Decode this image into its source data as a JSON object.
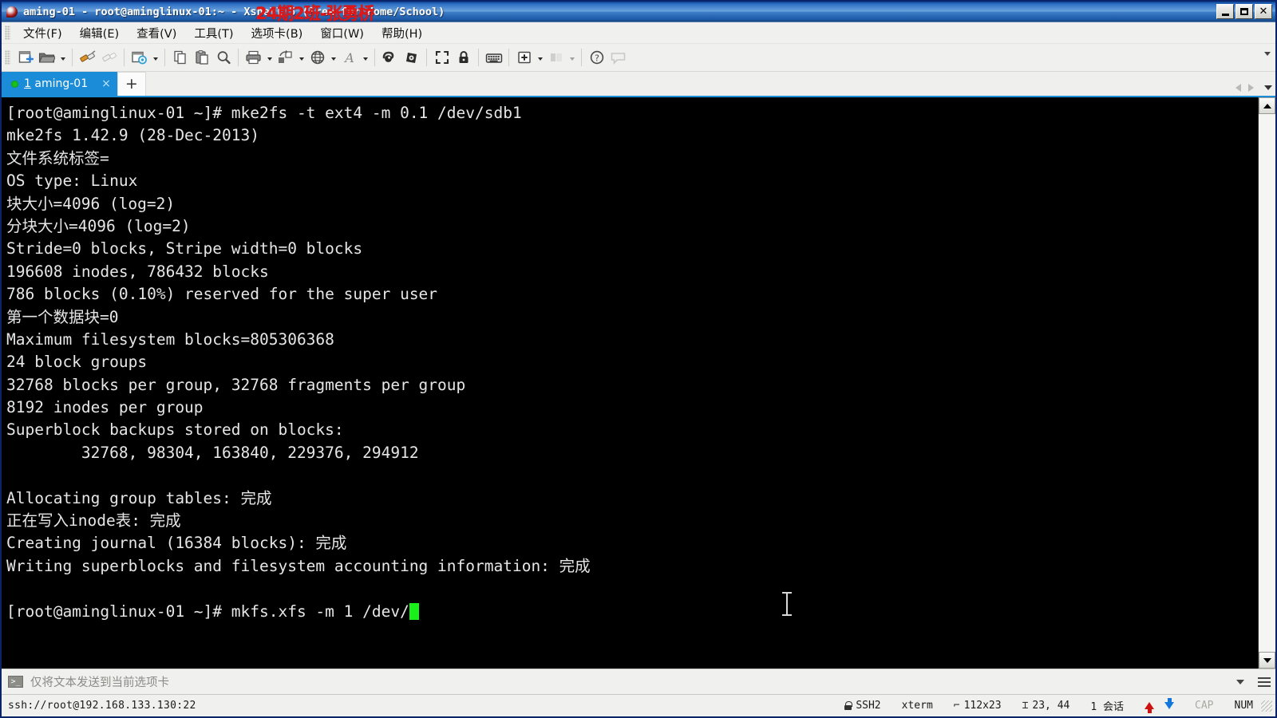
{
  "window": {
    "app_icon": "xshell-icon",
    "title": "aming-01 - root@aminglinux-01:~ - Xshell 5 (Free for Home/School)",
    "watermark": "24期2班-张勇桥",
    "minimize_label": "最小化",
    "maximize_label": "最大化",
    "close_label": "关闭"
  },
  "menubar": {
    "items": [
      {
        "label": "文件(F)",
        "name": "menu-file"
      },
      {
        "label": "编辑(E)",
        "name": "menu-edit"
      },
      {
        "label": "查看(V)",
        "name": "menu-view"
      },
      {
        "label": "工具(T)",
        "name": "menu-tools"
      },
      {
        "label": "选项卡(B)",
        "name": "menu-tabs"
      },
      {
        "label": "窗口(W)",
        "name": "menu-window"
      },
      {
        "label": "帮助(H)",
        "name": "menu-help"
      }
    ]
  },
  "toolbar": {
    "icons": [
      "new-session-icon",
      "open-folder-icon",
      "connect-plug-icon",
      "disconnect-plug-icon",
      "session-properties-icon",
      "copy-icon",
      "paste-icon",
      "find-icon",
      "print-icon",
      "file-transfer-icon",
      "web-browser-icon",
      "font-size-icon",
      "script-record-icon",
      "script-run-icon",
      "fullscreen-icon",
      "lock-session-icon",
      "keyboard-icon",
      "add-tab-icon",
      "arrange-layout-icon",
      "help-icon",
      "chat-icon"
    ]
  },
  "tabs": {
    "active": {
      "index": "1",
      "label": " aming-01",
      "status_dot_color": "#19c219",
      "close_label": "×"
    },
    "new_tab_label": "+",
    "nav_left": "prev-tab-arrow",
    "nav_right": "next-tab-arrow",
    "nav_menu": "tab-list-chevron"
  },
  "terminal": {
    "font_color": "#e6e6e6",
    "background": "#000000",
    "cursor_color": "#19f019",
    "lines": [
      "[root@aminglinux-01 ~]# mke2fs -t ext4 -m 0.1 /dev/sdb1",
      "mke2fs 1.42.9 (28-Dec-2013)",
      "文件系统标签=",
      "OS type: Linux",
      "块大小=4096 (log=2)",
      "分块大小=4096 (log=2)",
      "Stride=0 blocks, Stripe width=0 blocks",
      "196608 inodes, 786432 blocks",
      "786 blocks (0.10%) reserved for the super user",
      "第一个数据块=0",
      "Maximum filesystem blocks=805306368",
      "24 block groups",
      "32768 blocks per group, 32768 fragments per group",
      "8192 inodes per group",
      "Superblock backups stored on blocks:",
      "        32768, 98304, 163840, 229376, 294912",
      "",
      "Allocating group tables: 完成",
      "正在写入inode表: 完成",
      "Creating journal (16384 blocks): 完成",
      "Writing superblocks and filesystem accounting information: 完成",
      ""
    ],
    "prompt_line": "[root@aminglinux-01 ~]# mkfs.xfs -m 1 /dev/"
  },
  "command_bar": {
    "icon": "terminal-prompt-icon",
    "placeholder": "仅将文本发送到当前选项卡",
    "dropdown": "command-history-chevron",
    "menu": "command-bar-menu"
  },
  "statusbar": {
    "connection": "ssh://root@192.168.133.130:22",
    "protocol": "SSH2",
    "terminal_type": "xterm",
    "dimensions": "112x23",
    "cursor_position": "23, 44",
    "sessions": "1 会话",
    "upload_indicator": "upload-arrow",
    "download_indicator": "download-arrow",
    "caps_lock": "CAP",
    "num_lock": "NUM"
  }
}
